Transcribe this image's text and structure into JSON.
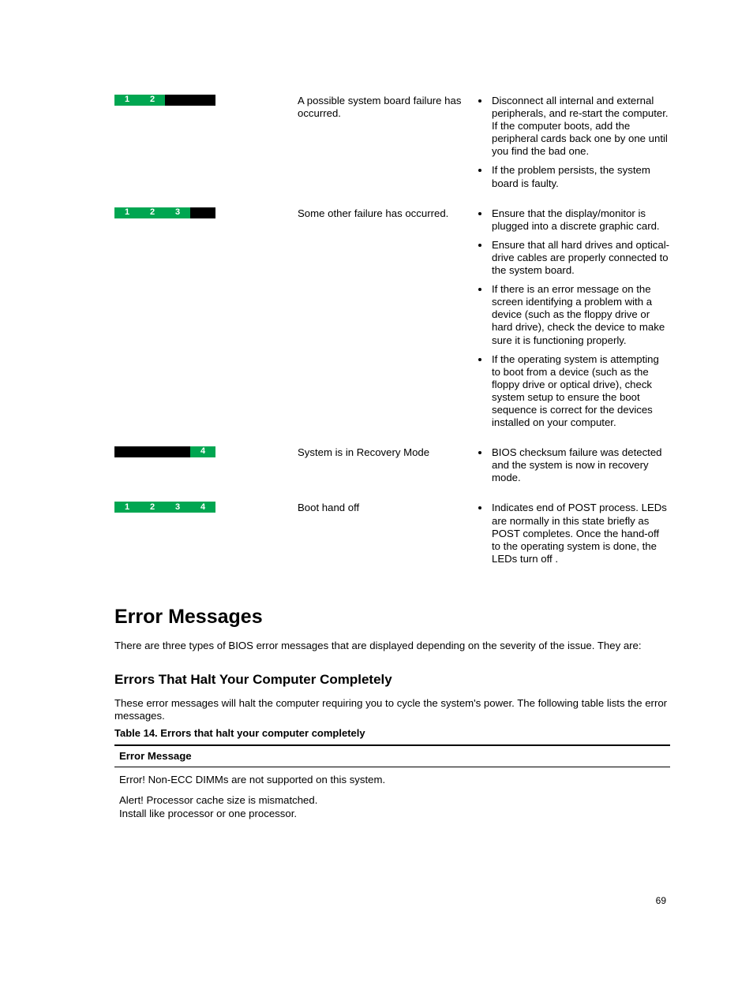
{
  "diagnostics": [
    {
      "leds": [
        true,
        true,
        false,
        false
      ],
      "description": "A possible system board failure has occurred.",
      "steps": [
        "Disconnect all internal and external peripherals, and re-start the computer. If the computer boots, add the peripheral cards back one by one until you find the bad one.",
        "If the problem persists, the system board is faulty."
      ]
    },
    {
      "leds": [
        true,
        true,
        true,
        false
      ],
      "description": "Some other failure has occurred.",
      "steps": [
        "Ensure that the display/monitor is plugged into a discrete graphic card.",
        "Ensure that all hard drives and optical-drive cables are properly connected to the system board.",
        "If there is an error message on the screen identifying a problem with a device (such as the floppy drive or hard drive), check the device to make sure it is functioning properly.",
        "If the operating system is attempting to boot from a device (such as the floppy drive or optical drive), check system setup to ensure the boot sequence is correct for the devices installed on your computer."
      ]
    },
    {
      "leds": [
        false,
        false,
        false,
        true
      ],
      "description": "System is in Recovery Mode",
      "steps": [
        "BIOS checksum failure was detected and the system is now in recovery mode."
      ]
    },
    {
      "leds": [
        true,
        true,
        true,
        true
      ],
      "description": "Boot hand off",
      "steps": [
        "Indicates end of POST process. LEDs are normally in this state briefly as POST completes. Once the hand-off to the operating system is done, the LEDs turn off ."
      ]
    }
  ],
  "section_heading": "Error Messages",
  "section_intro": "There are three types of BIOS error messages that are displayed depending on the severity of the issue. They are:",
  "subsection_heading": "Errors That Halt Your Computer Completely",
  "subsection_intro": "These error messages will halt the computer requiring you to cycle the system's power. The following table lists the error messages.",
  "table_caption": "Table 14. Errors that halt your computer completely",
  "error_table": {
    "header": "Error Message",
    "rows": [
      {
        "msg": "Error! Non-ECC DIMMs are not supported on this system.",
        "sub": ""
      },
      {
        "msg": "Alert! Processor cache size is mismatched.",
        "sub": "Install like processor or one processor."
      }
    ]
  },
  "page_number": "69"
}
